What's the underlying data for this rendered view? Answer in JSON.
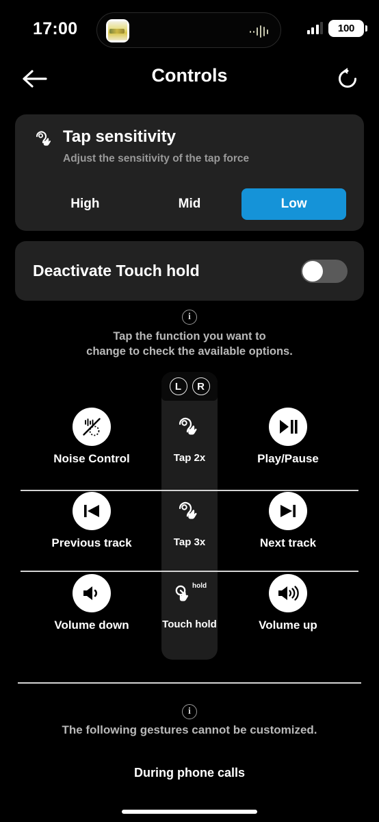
{
  "status_bar": {
    "time": "17:00",
    "battery_percent": "100",
    "signal_icon": "cellular-signal-icon",
    "island_app_icon": "media-app-artwork-icon",
    "island_viz_icon": "audio-waveform-icon"
  },
  "navbar": {
    "back_icon": "back-arrow-icon",
    "title": "Controls",
    "refresh_icon": "reset-refresh-icon"
  },
  "tap_sensitivity": {
    "icon": "ear-tap-icon",
    "title": "Tap sensitivity",
    "subtitle": "Adjust the sensitivity of the tap force",
    "options": [
      "High",
      "Mid",
      "Low"
    ],
    "selected": "Low",
    "accent_color": "#1593D8"
  },
  "touch_hold": {
    "label": "Deactivate Touch hold",
    "toggle_state": "off",
    "toggle_track_color": "#5a5a5a"
  },
  "info_top": {
    "icon": "info-circle-icon",
    "line1": "Tap the function you want to",
    "line2": "change to check the available options."
  },
  "gesture_matrix": {
    "earbud_badges": [
      "L",
      "R"
    ],
    "rows": [
      {
        "left": {
          "label": "Noise Control",
          "icon": "noise-control-icon"
        },
        "center": {
          "label": "Tap 2x",
          "icon": "ear-tap-icon"
        },
        "right": {
          "label": "Play/Pause",
          "icon": "play-pause-icon"
        }
      },
      {
        "left": {
          "label": "Previous track",
          "icon": "previous-track-icon"
        },
        "center": {
          "label": "Tap 3x",
          "icon": "ear-tap-icon"
        },
        "right": {
          "label": "Next track",
          "icon": "next-track-icon"
        }
      },
      {
        "left": {
          "label": "Volume down",
          "icon": "volume-down-icon"
        },
        "center": {
          "label": "Touch hold",
          "icon": "touch-hold-icon"
        },
        "right": {
          "label": "Volume up",
          "icon": "volume-up-icon"
        }
      }
    ]
  },
  "info_bottom": {
    "icon": "info-circle-icon",
    "text": "The following gestures cannot be customized."
  },
  "phone_calls_section": {
    "title": "During phone calls"
  },
  "home_indicator": "home-indicator"
}
